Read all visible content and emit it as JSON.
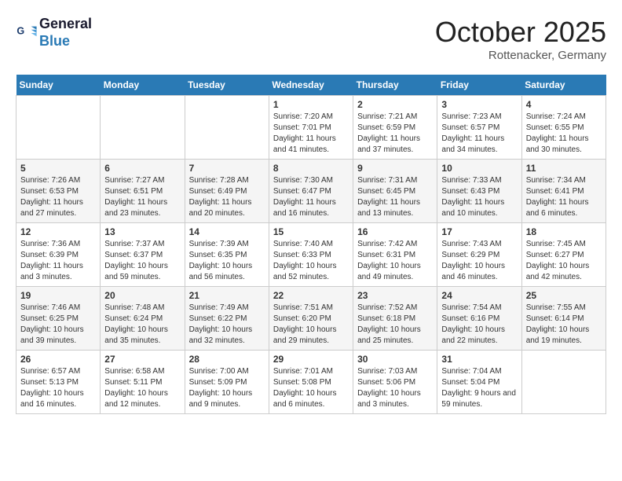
{
  "logo": {
    "line1": "General",
    "line2": "Blue"
  },
  "title": "October 2025",
  "location": "Rottenacker, Germany",
  "days_header": [
    "Sunday",
    "Monday",
    "Tuesday",
    "Wednesday",
    "Thursday",
    "Friday",
    "Saturday"
  ],
  "weeks": [
    [
      {
        "day": "",
        "info": ""
      },
      {
        "day": "",
        "info": ""
      },
      {
        "day": "",
        "info": ""
      },
      {
        "day": "1",
        "info": "Sunrise: 7:20 AM\nSunset: 7:01 PM\nDaylight: 11 hours and 41 minutes."
      },
      {
        "day": "2",
        "info": "Sunrise: 7:21 AM\nSunset: 6:59 PM\nDaylight: 11 hours and 37 minutes."
      },
      {
        "day": "3",
        "info": "Sunrise: 7:23 AM\nSunset: 6:57 PM\nDaylight: 11 hours and 34 minutes."
      },
      {
        "day": "4",
        "info": "Sunrise: 7:24 AM\nSunset: 6:55 PM\nDaylight: 11 hours and 30 minutes."
      }
    ],
    [
      {
        "day": "5",
        "info": "Sunrise: 7:26 AM\nSunset: 6:53 PM\nDaylight: 11 hours and 27 minutes."
      },
      {
        "day": "6",
        "info": "Sunrise: 7:27 AM\nSunset: 6:51 PM\nDaylight: 11 hours and 23 minutes."
      },
      {
        "day": "7",
        "info": "Sunrise: 7:28 AM\nSunset: 6:49 PM\nDaylight: 11 hours and 20 minutes."
      },
      {
        "day": "8",
        "info": "Sunrise: 7:30 AM\nSunset: 6:47 PM\nDaylight: 11 hours and 16 minutes."
      },
      {
        "day": "9",
        "info": "Sunrise: 7:31 AM\nSunset: 6:45 PM\nDaylight: 11 hours and 13 minutes."
      },
      {
        "day": "10",
        "info": "Sunrise: 7:33 AM\nSunset: 6:43 PM\nDaylight: 11 hours and 10 minutes."
      },
      {
        "day": "11",
        "info": "Sunrise: 7:34 AM\nSunset: 6:41 PM\nDaylight: 11 hours and 6 minutes."
      }
    ],
    [
      {
        "day": "12",
        "info": "Sunrise: 7:36 AM\nSunset: 6:39 PM\nDaylight: 11 hours and 3 minutes."
      },
      {
        "day": "13",
        "info": "Sunrise: 7:37 AM\nSunset: 6:37 PM\nDaylight: 10 hours and 59 minutes."
      },
      {
        "day": "14",
        "info": "Sunrise: 7:39 AM\nSunset: 6:35 PM\nDaylight: 10 hours and 56 minutes."
      },
      {
        "day": "15",
        "info": "Sunrise: 7:40 AM\nSunset: 6:33 PM\nDaylight: 10 hours and 52 minutes."
      },
      {
        "day": "16",
        "info": "Sunrise: 7:42 AM\nSunset: 6:31 PM\nDaylight: 10 hours and 49 minutes."
      },
      {
        "day": "17",
        "info": "Sunrise: 7:43 AM\nSunset: 6:29 PM\nDaylight: 10 hours and 46 minutes."
      },
      {
        "day": "18",
        "info": "Sunrise: 7:45 AM\nSunset: 6:27 PM\nDaylight: 10 hours and 42 minutes."
      }
    ],
    [
      {
        "day": "19",
        "info": "Sunrise: 7:46 AM\nSunset: 6:25 PM\nDaylight: 10 hours and 39 minutes."
      },
      {
        "day": "20",
        "info": "Sunrise: 7:48 AM\nSunset: 6:24 PM\nDaylight: 10 hours and 35 minutes."
      },
      {
        "day": "21",
        "info": "Sunrise: 7:49 AM\nSunset: 6:22 PM\nDaylight: 10 hours and 32 minutes."
      },
      {
        "day": "22",
        "info": "Sunrise: 7:51 AM\nSunset: 6:20 PM\nDaylight: 10 hours and 29 minutes."
      },
      {
        "day": "23",
        "info": "Sunrise: 7:52 AM\nSunset: 6:18 PM\nDaylight: 10 hours and 25 minutes."
      },
      {
        "day": "24",
        "info": "Sunrise: 7:54 AM\nSunset: 6:16 PM\nDaylight: 10 hours and 22 minutes."
      },
      {
        "day": "25",
        "info": "Sunrise: 7:55 AM\nSunset: 6:14 PM\nDaylight: 10 hours and 19 minutes."
      }
    ],
    [
      {
        "day": "26",
        "info": "Sunrise: 6:57 AM\nSunset: 5:13 PM\nDaylight: 10 hours and 16 minutes."
      },
      {
        "day": "27",
        "info": "Sunrise: 6:58 AM\nSunset: 5:11 PM\nDaylight: 10 hours and 12 minutes."
      },
      {
        "day": "28",
        "info": "Sunrise: 7:00 AM\nSunset: 5:09 PM\nDaylight: 10 hours and 9 minutes."
      },
      {
        "day": "29",
        "info": "Sunrise: 7:01 AM\nSunset: 5:08 PM\nDaylight: 10 hours and 6 minutes."
      },
      {
        "day": "30",
        "info": "Sunrise: 7:03 AM\nSunset: 5:06 PM\nDaylight: 10 hours and 3 minutes."
      },
      {
        "day": "31",
        "info": "Sunrise: 7:04 AM\nSunset: 5:04 PM\nDaylight: 9 hours and 59 minutes."
      },
      {
        "day": "",
        "info": ""
      }
    ]
  ]
}
